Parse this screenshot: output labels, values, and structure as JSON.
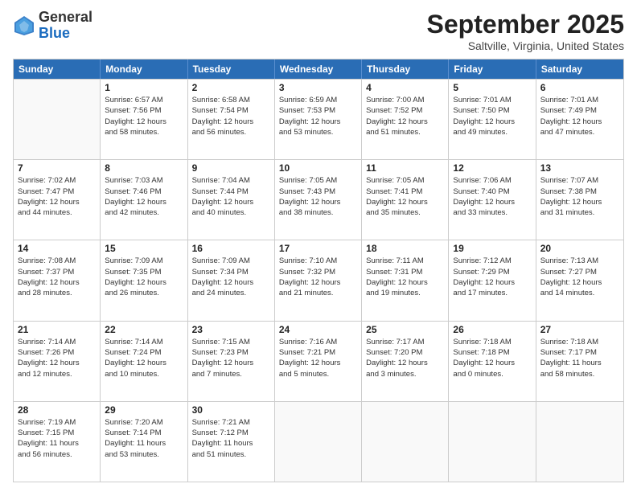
{
  "header": {
    "logo": {
      "line1": "General",
      "line2": "Blue"
    },
    "title": "September 2025",
    "location": "Saltville, Virginia, United States"
  },
  "weekdays": [
    "Sunday",
    "Monday",
    "Tuesday",
    "Wednesday",
    "Thursday",
    "Friday",
    "Saturday"
  ],
  "weeks": [
    [
      {
        "day": "",
        "info": ""
      },
      {
        "day": "1",
        "info": "Sunrise: 6:57 AM\nSunset: 7:56 PM\nDaylight: 12 hours\nand 58 minutes."
      },
      {
        "day": "2",
        "info": "Sunrise: 6:58 AM\nSunset: 7:54 PM\nDaylight: 12 hours\nand 56 minutes."
      },
      {
        "day": "3",
        "info": "Sunrise: 6:59 AM\nSunset: 7:53 PM\nDaylight: 12 hours\nand 53 minutes."
      },
      {
        "day": "4",
        "info": "Sunrise: 7:00 AM\nSunset: 7:52 PM\nDaylight: 12 hours\nand 51 minutes."
      },
      {
        "day": "5",
        "info": "Sunrise: 7:01 AM\nSunset: 7:50 PM\nDaylight: 12 hours\nand 49 minutes."
      },
      {
        "day": "6",
        "info": "Sunrise: 7:01 AM\nSunset: 7:49 PM\nDaylight: 12 hours\nand 47 minutes."
      }
    ],
    [
      {
        "day": "7",
        "info": "Sunrise: 7:02 AM\nSunset: 7:47 PM\nDaylight: 12 hours\nand 44 minutes."
      },
      {
        "day": "8",
        "info": "Sunrise: 7:03 AM\nSunset: 7:46 PM\nDaylight: 12 hours\nand 42 minutes."
      },
      {
        "day": "9",
        "info": "Sunrise: 7:04 AM\nSunset: 7:44 PM\nDaylight: 12 hours\nand 40 minutes."
      },
      {
        "day": "10",
        "info": "Sunrise: 7:05 AM\nSunset: 7:43 PM\nDaylight: 12 hours\nand 38 minutes."
      },
      {
        "day": "11",
        "info": "Sunrise: 7:05 AM\nSunset: 7:41 PM\nDaylight: 12 hours\nand 35 minutes."
      },
      {
        "day": "12",
        "info": "Sunrise: 7:06 AM\nSunset: 7:40 PM\nDaylight: 12 hours\nand 33 minutes."
      },
      {
        "day": "13",
        "info": "Sunrise: 7:07 AM\nSunset: 7:38 PM\nDaylight: 12 hours\nand 31 minutes."
      }
    ],
    [
      {
        "day": "14",
        "info": "Sunrise: 7:08 AM\nSunset: 7:37 PM\nDaylight: 12 hours\nand 28 minutes."
      },
      {
        "day": "15",
        "info": "Sunrise: 7:09 AM\nSunset: 7:35 PM\nDaylight: 12 hours\nand 26 minutes."
      },
      {
        "day": "16",
        "info": "Sunrise: 7:09 AM\nSunset: 7:34 PM\nDaylight: 12 hours\nand 24 minutes."
      },
      {
        "day": "17",
        "info": "Sunrise: 7:10 AM\nSunset: 7:32 PM\nDaylight: 12 hours\nand 21 minutes."
      },
      {
        "day": "18",
        "info": "Sunrise: 7:11 AM\nSunset: 7:31 PM\nDaylight: 12 hours\nand 19 minutes."
      },
      {
        "day": "19",
        "info": "Sunrise: 7:12 AM\nSunset: 7:29 PM\nDaylight: 12 hours\nand 17 minutes."
      },
      {
        "day": "20",
        "info": "Sunrise: 7:13 AM\nSunset: 7:27 PM\nDaylight: 12 hours\nand 14 minutes."
      }
    ],
    [
      {
        "day": "21",
        "info": "Sunrise: 7:14 AM\nSunset: 7:26 PM\nDaylight: 12 hours\nand 12 minutes."
      },
      {
        "day": "22",
        "info": "Sunrise: 7:14 AM\nSunset: 7:24 PM\nDaylight: 12 hours\nand 10 minutes."
      },
      {
        "day": "23",
        "info": "Sunrise: 7:15 AM\nSunset: 7:23 PM\nDaylight: 12 hours\nand 7 minutes."
      },
      {
        "day": "24",
        "info": "Sunrise: 7:16 AM\nSunset: 7:21 PM\nDaylight: 12 hours\nand 5 minutes."
      },
      {
        "day": "25",
        "info": "Sunrise: 7:17 AM\nSunset: 7:20 PM\nDaylight: 12 hours\nand 3 minutes."
      },
      {
        "day": "26",
        "info": "Sunrise: 7:18 AM\nSunset: 7:18 PM\nDaylight: 12 hours\nand 0 minutes."
      },
      {
        "day": "27",
        "info": "Sunrise: 7:18 AM\nSunset: 7:17 PM\nDaylight: 11 hours\nand 58 minutes."
      }
    ],
    [
      {
        "day": "28",
        "info": "Sunrise: 7:19 AM\nSunset: 7:15 PM\nDaylight: 11 hours\nand 56 minutes."
      },
      {
        "day": "29",
        "info": "Sunrise: 7:20 AM\nSunset: 7:14 PM\nDaylight: 11 hours\nand 53 minutes."
      },
      {
        "day": "30",
        "info": "Sunrise: 7:21 AM\nSunset: 7:12 PM\nDaylight: 11 hours\nand 51 minutes."
      },
      {
        "day": "",
        "info": ""
      },
      {
        "day": "",
        "info": ""
      },
      {
        "day": "",
        "info": ""
      },
      {
        "day": "",
        "info": ""
      }
    ]
  ]
}
